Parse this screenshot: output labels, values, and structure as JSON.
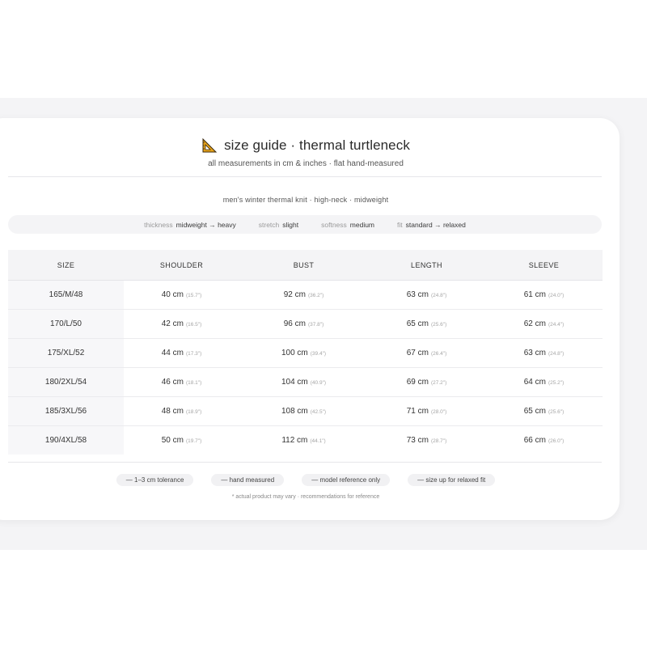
{
  "header": {
    "title": "size guide · thermal turtleneck",
    "subtitle": "all measurements in cm & inches · flat hand-measured",
    "icon": "triangle-ruler-icon"
  },
  "caption": "men's winter thermal knit · high-neck · midweight",
  "properties": [
    {
      "key": "thickness",
      "value": "midweight → heavy"
    },
    {
      "key": "stretch",
      "value": "slight"
    },
    {
      "key": "softness",
      "value": "medium"
    },
    {
      "key": "fit",
      "value": "standard → relaxed"
    }
  ],
  "table": {
    "headers": [
      "SIZE",
      "SHOULDER",
      "BUST",
      "LENGTH",
      "SLEEVE"
    ],
    "rows": [
      {
        "size": "165/M/48",
        "shoulder": "40 cm",
        "shoulder_in": "(15.7\")",
        "bust": "92 cm",
        "bust_in": "(36.2\")",
        "length": "63 cm",
        "length_in": "(24.8\")",
        "sleeve": "61 cm",
        "sleeve_in": "(24.0\")"
      },
      {
        "size": "170/L/50",
        "shoulder": "42 cm",
        "shoulder_in": "(16.5\")",
        "bust": "96 cm",
        "bust_in": "(37.8\")",
        "length": "65 cm",
        "length_in": "(25.6\")",
        "sleeve": "62 cm",
        "sleeve_in": "(24.4\")"
      },
      {
        "size": "175/XL/52",
        "shoulder": "44 cm",
        "shoulder_in": "(17.3\")",
        "bust": "100 cm",
        "bust_in": "(39.4\")",
        "length": "67 cm",
        "length_in": "(26.4\")",
        "sleeve": "63 cm",
        "sleeve_in": "(24.8\")"
      },
      {
        "size": "180/2XL/54",
        "shoulder": "46 cm",
        "shoulder_in": "(18.1\")",
        "bust": "104 cm",
        "bust_in": "(40.9\")",
        "length": "69 cm",
        "length_in": "(27.2\")",
        "sleeve": "64 cm",
        "sleeve_in": "(25.2\")"
      },
      {
        "size": "185/3XL/56",
        "shoulder": "48 cm",
        "shoulder_in": "(18.9\")",
        "bust": "108 cm",
        "bust_in": "(42.5\")",
        "length": "71 cm",
        "length_in": "(28.0\")",
        "sleeve": "65 cm",
        "sleeve_in": "(25.6\")"
      },
      {
        "size": "190/4XL/58",
        "shoulder": "50 cm",
        "shoulder_in": "(19.7\")",
        "bust": "112 cm",
        "bust_in": "(44.1\")",
        "length": "73 cm",
        "length_in": "(28.7\")",
        "sleeve": "66 cm",
        "sleeve_in": "(26.0\")"
      }
    ]
  },
  "notes": [
    "— 1–3 cm tolerance",
    "— hand measured",
    "— model reference only",
    "— size up for relaxed fit"
  ],
  "footnote": "* actual product may vary · recommendations for reference",
  "colors": {
    "background": "#ffffff",
    "band": "#f4f4f6",
    "card": "#ffffff",
    "accent": "#e8a317"
  }
}
